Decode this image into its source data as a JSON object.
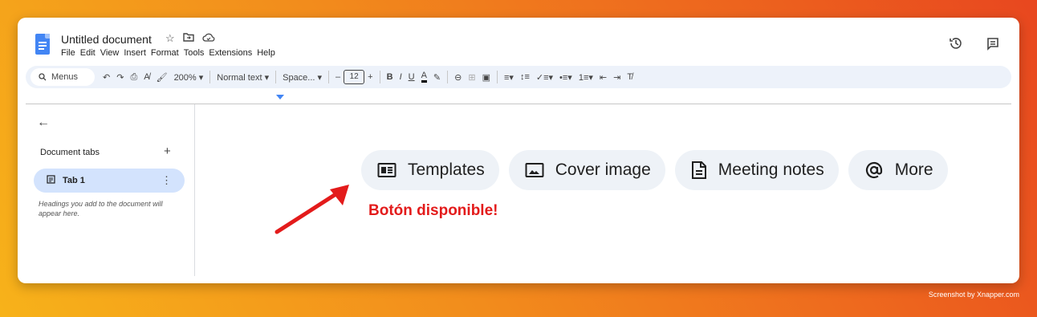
{
  "document": {
    "title": "Untitled document",
    "menus": [
      "File",
      "Edit",
      "View",
      "Insert",
      "Format",
      "Tools",
      "Extensions",
      "Help"
    ]
  },
  "toolbar": {
    "search_label": "Menus",
    "zoom": "200%",
    "style": "Normal text",
    "font": "Space...",
    "font_size": "12",
    "minus": "–",
    "plus": "+"
  },
  "sidebar": {
    "back": "←",
    "tabs_header": "Document tabs",
    "add": "+",
    "tab_label": "Tab 1",
    "hint": "Headings you add to the document will appear here."
  },
  "chips": [
    {
      "label": "Templates",
      "icon": "templates-icon"
    },
    {
      "label": "Cover image",
      "icon": "image-icon"
    },
    {
      "label": "Meeting notes",
      "icon": "notes-icon"
    },
    {
      "label": "More",
      "icon": "at-icon"
    }
  ],
  "annotation": "Botón disponible!",
  "credit": "Screenshot by Xnapper.com",
  "colors": {
    "accent": "#4285f4",
    "tab_selected": "#d3e3fd",
    "annotation": "#e31b1b"
  }
}
